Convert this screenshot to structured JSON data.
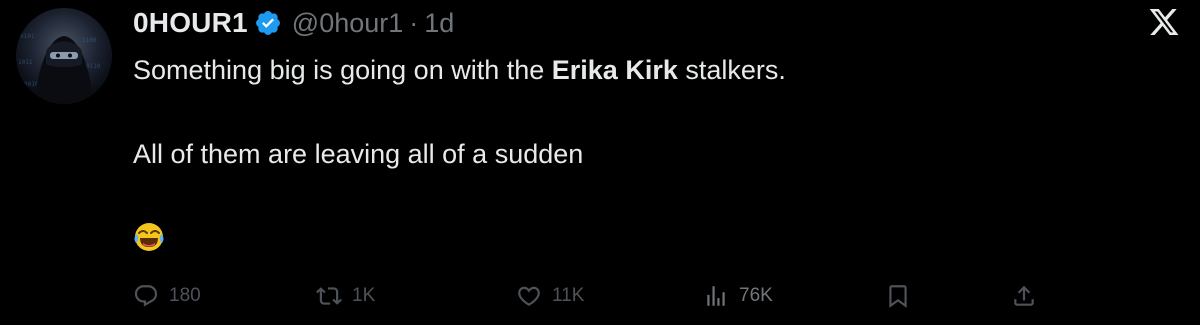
{
  "tweet": {
    "display_name": "0HOUR1",
    "handle": "@0hour1",
    "separator": "·",
    "timestamp": "1d",
    "text_line1_before": "Something big is going on with the ",
    "text_line1_bold": "Erika Kirk",
    "text_line1_after": " stalkers.",
    "text_line2": "All of them are leaving all of a sudden",
    "emoji_name": "face-with-tears-of-joy"
  },
  "actions": {
    "replies": "180",
    "reposts": "1K",
    "likes": "11K",
    "views": "76K"
  },
  "colors": {
    "background": "#000000",
    "primary_text": "#e7e9ea",
    "secondary_text": "#71767b",
    "verified": "#1d9bf0",
    "dim_icon": "#4e5359"
  },
  "icons": [
    "x-logo-icon",
    "verified-badge-icon",
    "reply-icon",
    "retweet-icon",
    "like-icon",
    "views-icon",
    "bookmark-icon",
    "share-icon"
  ]
}
